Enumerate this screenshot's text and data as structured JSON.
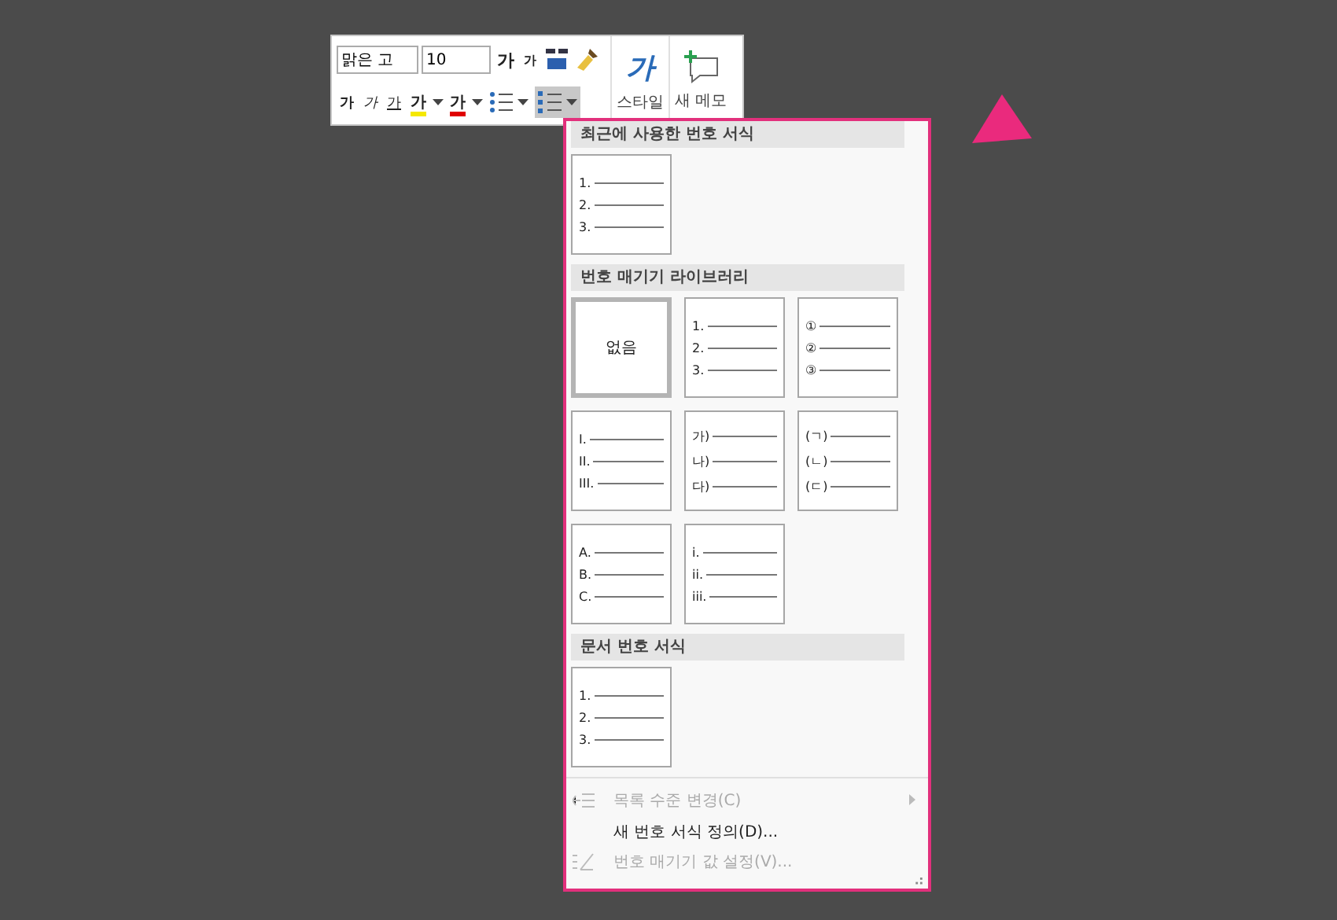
{
  "toolbar": {
    "font_name": "맑은 고",
    "font_size": "10",
    "row1": [
      {
        "kind": "grow",
        "label": "가"
      },
      {
        "kind": "shrink",
        "label": "가"
      },
      {
        "kind": "phonetic"
      },
      {
        "kind": "painter"
      }
    ],
    "row2": [
      {
        "kind": "bold",
        "label": "가",
        "selected": false
      },
      {
        "kind": "italic",
        "label": "가",
        "selected": false
      },
      {
        "kind": "underline",
        "label": "가",
        "selected": false
      },
      {
        "kind": "highlight",
        "label": "가",
        "color": "#f5e800",
        "selected": false
      },
      {
        "kind": "fontcolor",
        "label": "가",
        "color": "#e00000",
        "selected": false
      },
      {
        "kind": "bullets",
        "selected": false
      },
      {
        "kind": "numbering",
        "selected": true
      }
    ],
    "big": [
      {
        "kind": "style",
        "glyph": "가",
        "label": "스타일"
      },
      {
        "kind": "memo",
        "label": "새 메모"
      }
    ]
  },
  "gallery": [
    {
      "title": "최근에 사용한 번호 서식",
      "tiles": [
        {
          "kind": "list",
          "markers": [
            "1.",
            "2.",
            "3."
          ],
          "selected": false
        }
      ]
    },
    {
      "title": "번호 매기기 라이브러리",
      "tiles": [
        {
          "kind": "none",
          "label": "없음",
          "selected": true
        },
        {
          "kind": "list",
          "markers": [
            "1.",
            "2.",
            "3."
          ],
          "selected": false
        },
        {
          "kind": "list",
          "markers": [
            "①",
            "②",
            "③"
          ],
          "selected": false
        },
        {
          "kind": "list",
          "markers": [
            "I.",
            "II.",
            "III."
          ],
          "selected": false
        },
        {
          "kind": "list",
          "markers": [
            "가)",
            "나)",
            "다)"
          ],
          "selected": false
        },
        {
          "kind": "list",
          "markers": [
            "(ㄱ)",
            "(ㄴ)",
            "(ㄷ)"
          ],
          "selected": false
        },
        {
          "kind": "list",
          "markers": [
            "A.",
            "B.",
            "C."
          ],
          "selected": false
        },
        {
          "kind": "list",
          "markers": [
            "i.",
            "ii.",
            "iii."
          ],
          "selected": false
        }
      ]
    },
    {
      "title": "문서 번호 서식",
      "tiles": [
        {
          "kind": "list",
          "markers": [
            "1.",
            "2.",
            "3."
          ],
          "selected": false
        }
      ]
    }
  ],
  "menu": [
    {
      "kind": "level",
      "label": "목록 수준 변경(C)",
      "disabled": true,
      "submenu": true
    },
    {
      "kind": "plain",
      "label": "새 번호 서식 정의(D)...",
      "disabled": false,
      "submenu": false
    },
    {
      "kind": "value",
      "label": "번호 매기기 값 설정(V)...",
      "disabled": true,
      "submenu": false
    }
  ]
}
